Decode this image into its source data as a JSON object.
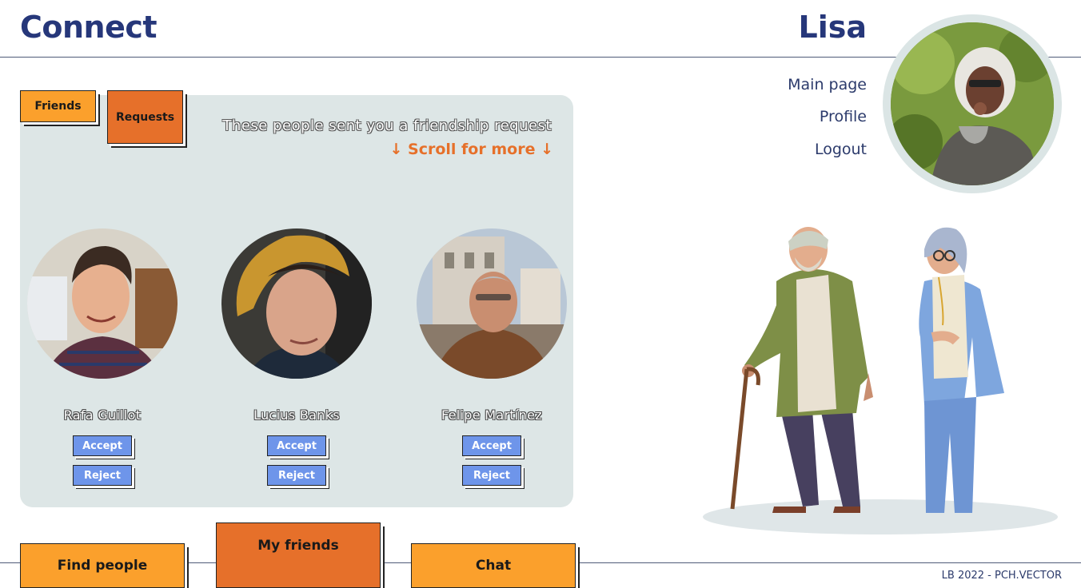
{
  "header": {
    "logo": "Connect",
    "username": "Lisa"
  },
  "nav": {
    "main_page": "Main page",
    "profile": "Profile",
    "logout": "Logout"
  },
  "tabs": {
    "friends": "Friends",
    "requests": "Requests"
  },
  "requests_panel": {
    "title": "These people sent you a friendship request",
    "scroll_hint": "↓ Scroll for more ↓",
    "people": [
      {
        "name": "Rafa Guillot",
        "accept": "Accept",
        "reject": "Reject"
      },
      {
        "name": "Lucius Banks",
        "accept": "Accept",
        "reject": "Reject"
      },
      {
        "name": "Felipe Martínez",
        "accept": "Accept",
        "reject": "Reject"
      }
    ]
  },
  "bottom_nav": {
    "find_people": "Find people",
    "my_friends": "My friends",
    "chat": "Chat"
  },
  "footer": {
    "credit": "LB 2022 - PCH.VECTOR"
  },
  "colors": {
    "brand_blue": "#26377a",
    "orange": "#fba02c",
    "dark_orange": "#e6702a",
    "button_blue": "#6e95ea",
    "panel_bg": "#dde6e6"
  }
}
